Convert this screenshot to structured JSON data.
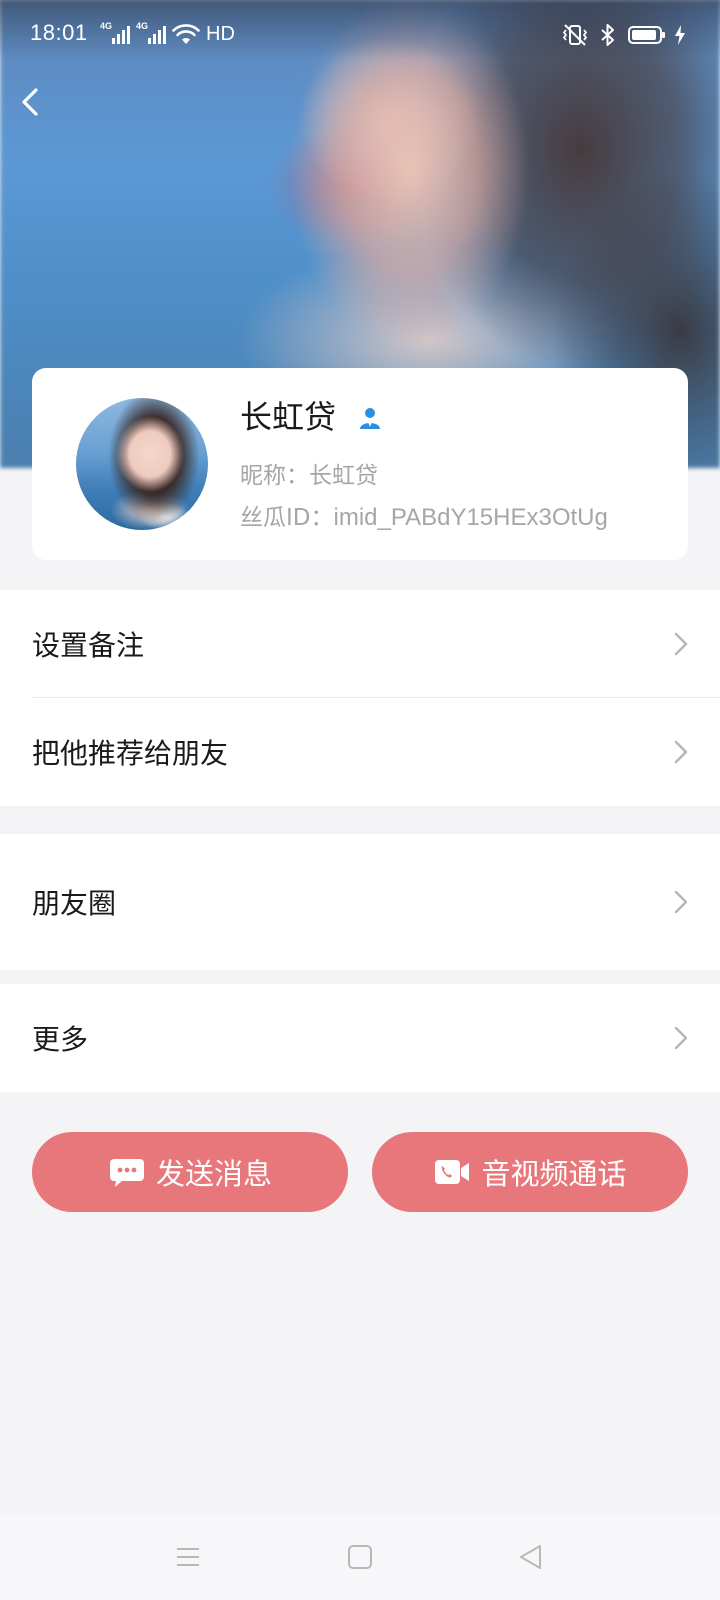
{
  "status_bar": {
    "time": "18:01",
    "network_1": "4G",
    "network_2": "4G",
    "hd_label": "HD",
    "icons": [
      "signal-icon",
      "signal-icon",
      "wifi-icon",
      "vibrate-icon",
      "bluetooth-icon",
      "battery-icon",
      "charging-icon"
    ],
    "battery_level": 0.85
  },
  "header": {
    "back_icon": "chevron-left-icon"
  },
  "profile": {
    "name": "长虹贷",
    "badge_icon": "person-icon",
    "nickname_label": "昵称：",
    "nickname": "长虹贷",
    "id_label": "丝瓜ID：",
    "id_value": "imid_PABdY15HEx3OtUg"
  },
  "menu": {
    "set_remark": "设置备注",
    "recommend": "把他推荐给朋友",
    "moments": "朋友圈",
    "more": "更多"
  },
  "actions": {
    "send_message": "发送消息",
    "av_call": "音视频通话",
    "accent_color": "#e8777b"
  },
  "nav": {
    "icons": [
      "menu-icon",
      "home-icon",
      "back-triangle-icon"
    ]
  }
}
